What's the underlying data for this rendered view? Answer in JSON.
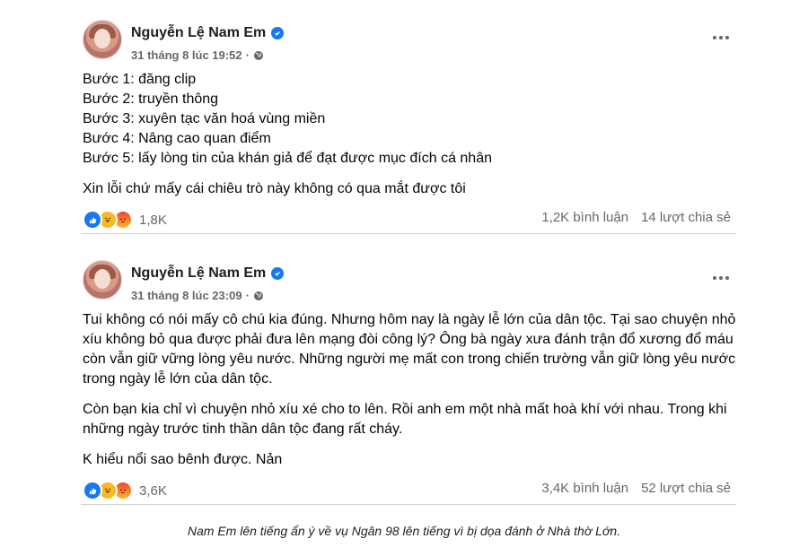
{
  "posts": [
    {
      "author": "Nguyễn Lệ Nam Em",
      "timestamp": "31 tháng 8 lúc 19:52",
      "meta_separator": "·",
      "privacy_icon": "globe-icon",
      "lines": [
        "Bước 1: đăng clip",
        "Bước 2: truyền thông",
        "Bước 3: xuyên tạc văn hoá vùng miền",
        "Bước 4: Nâng cao quan điểm",
        "Bước 5: lấy lòng tin của khán giả để đạt được mục đích cá nhân"
      ],
      "extra": "Xin lỗi chứ mấy cái chiêu trò này không có qua mắt được tôi",
      "reaction_count": "1,8K",
      "comments": "1,2K bình luận",
      "shares": "14 lượt chia sẻ"
    },
    {
      "author": "Nguyễn Lệ Nam Em",
      "timestamp": "31 tháng 8 lúc 23:09",
      "meta_separator": "·",
      "privacy_icon": "globe-icon",
      "paragraphs": [
        "Tui không có nói mấy cô chú kia đúng. Nhưng hôm nay là ngày lễ lớn của dân tộc. Tại sao chuyện nhỏ xíu không bỏ qua được phải đưa lên mạng đòi công lý? Ông bà ngày xưa đánh trận đổ xương đổ máu còn vẫn giữ vững lòng yêu nước. Những người mẹ mất con trong chiến trường vẫn giữ lòng yêu nước trong ngày lễ lớn của dân tộc.",
        "Còn bạn kia chỉ vì chuyện nhỏ xíu xé cho to lên. Rồi anh em một nhà mất hoà khí với nhau. Trong khi những ngày trước tinh thần dân tộc đang rất cháy.",
        "K hiểu nổi sao bênh được. Nản"
      ],
      "reaction_count": "3,6K",
      "comments": "3,4K bình luận",
      "shares": "52 lượt chia sẻ"
    }
  ],
  "caption": "Nam Em lên tiếng ẩn ý về vụ Ngân 98 lên tiếng vì bị dọa đánh ở Nhà thờ Lớn.",
  "colors": {
    "accent": "#1877f2",
    "secondary_text": "#65676b",
    "divider": "#ced0d4"
  }
}
